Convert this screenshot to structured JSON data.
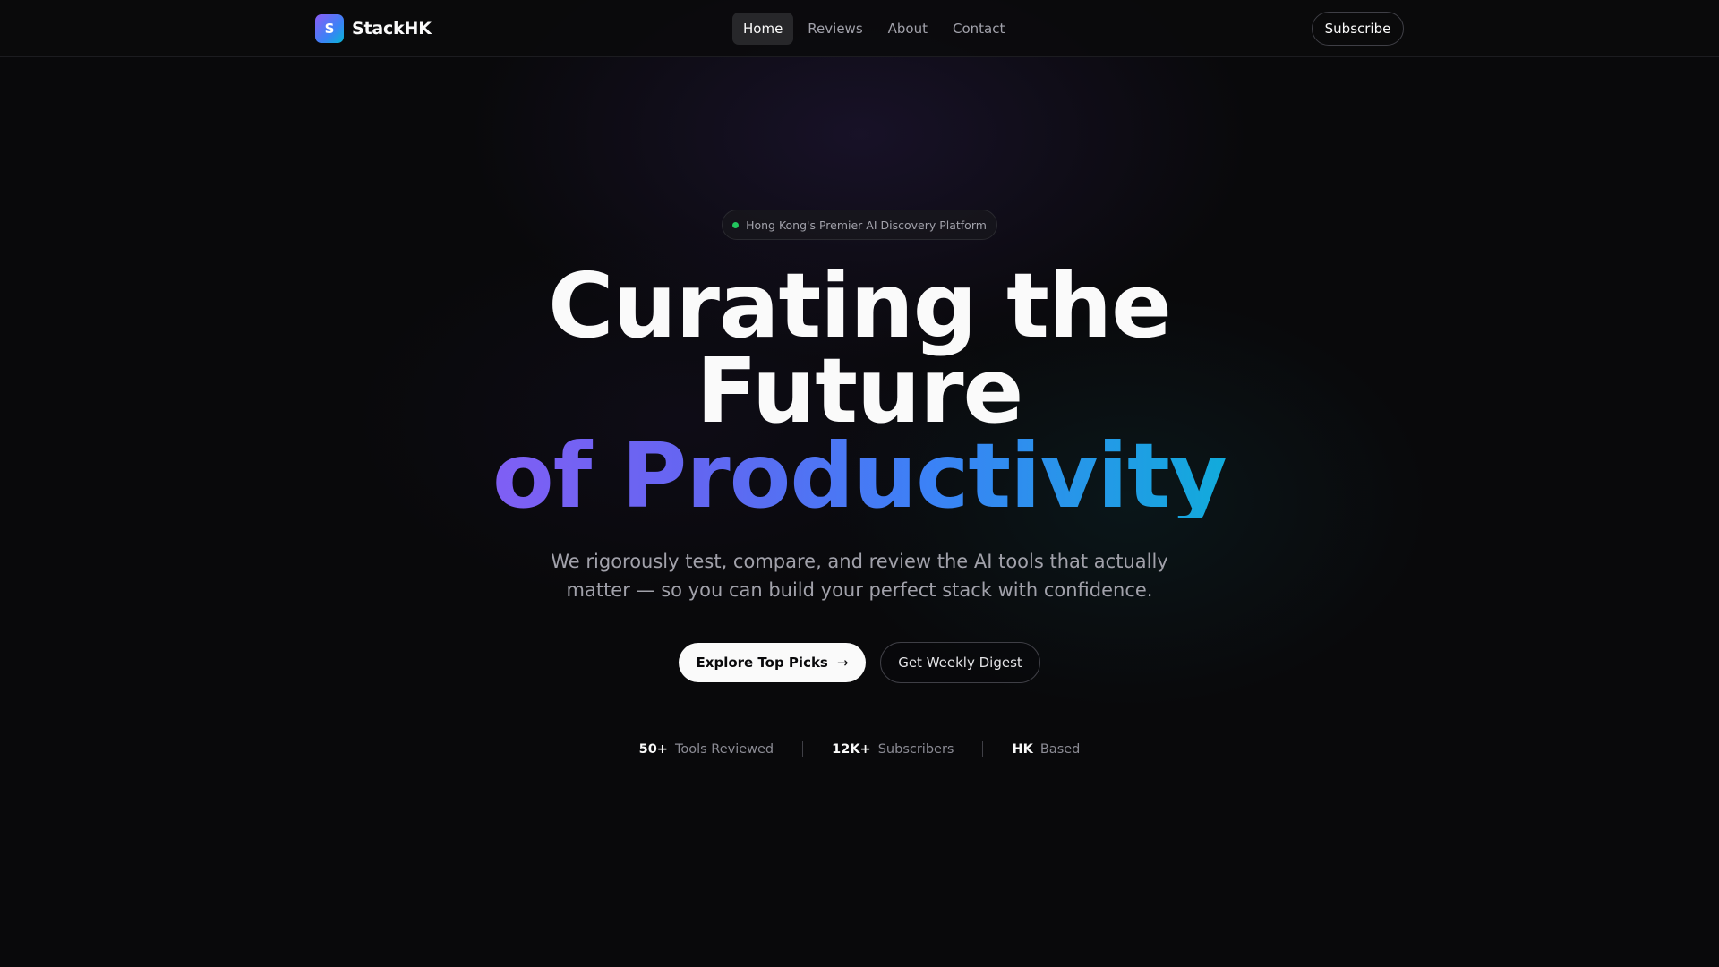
{
  "nav": {
    "logo_letter": "S",
    "brand": "StackHK",
    "links": [
      {
        "label": "Home",
        "active": true
      },
      {
        "label": "Reviews",
        "active": false
      },
      {
        "label": "About",
        "active": false
      },
      {
        "label": "Contact",
        "active": false
      }
    ],
    "subscribe_label": "Subscribe"
  },
  "hero": {
    "badge": "Hong Kong's Premier AI Discovery Platform",
    "headline_line1": "Curating the",
    "headline_line2": "Future",
    "headline_line3": "of Productivity",
    "subtitle": "We rigorously test, compare, and review the AI tools that actually matter — so you can build your perfect stack with confidence.",
    "primary_cta": "Explore Top Picks",
    "primary_cta_icon": "arrow-right-icon",
    "secondary_cta": "Get Weekly Digest"
  },
  "stats": [
    {
      "value": "50+",
      "label": "Tools Reviewed"
    },
    {
      "value": "12K+",
      "label": "Subscribers"
    },
    {
      "value": "HK",
      "label": "Based"
    }
  ],
  "colors": {
    "background": "#09090b",
    "accent_violet": "#8b5cf6",
    "accent_blue": "#3b82f6",
    "accent_cyan": "#06b6d4",
    "status_green": "#22c55e"
  }
}
